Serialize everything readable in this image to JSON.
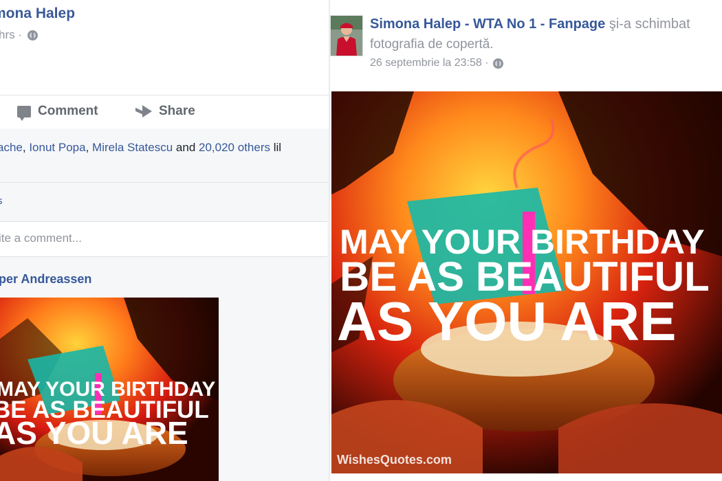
{
  "left_post": {
    "author_name": "mona Halep",
    "time_ago": "hrs ·",
    "actions": {
      "comment_label": "Comment",
      "share_label": "Share"
    },
    "likes": {
      "names": [
        "ache",
        "Ionut Popa",
        "Mirela Statescu"
      ],
      "and_text": " and ",
      "others_link": "20,020 others",
      "trailing": " lil"
    },
    "sub_label": "s",
    "comment_placeholder": "ite a comment...",
    "commenter_name": "per Andreassen",
    "image": {
      "lines": [
        "MAY YOUR BIRTHDAY",
        "BE AS BEAUTIFUL",
        "AS YOU ARE"
      ]
    }
  },
  "right_post": {
    "page_name": "Simona Halep - WTA No 1 - Fanpage",
    "action_text_1": "şi-a schimbat",
    "action_text_2": "fotografia de copertă.",
    "timestamp": "26 septembrie la 23:58 ·",
    "image": {
      "lines": [
        "MAY YOUR BIRTHDAY",
        "BE AS BEAUTIFUL",
        "AS YOU ARE"
      ],
      "watermark": "WishesQuotes.com"
    }
  },
  "icons": {
    "globe": "globe-icon",
    "comment": "comment-icon",
    "share": "share-icon"
  },
  "colors": {
    "link_blue": "#365899",
    "muted_gray": "#90949c",
    "panel_gray": "#f6f7f9"
  }
}
